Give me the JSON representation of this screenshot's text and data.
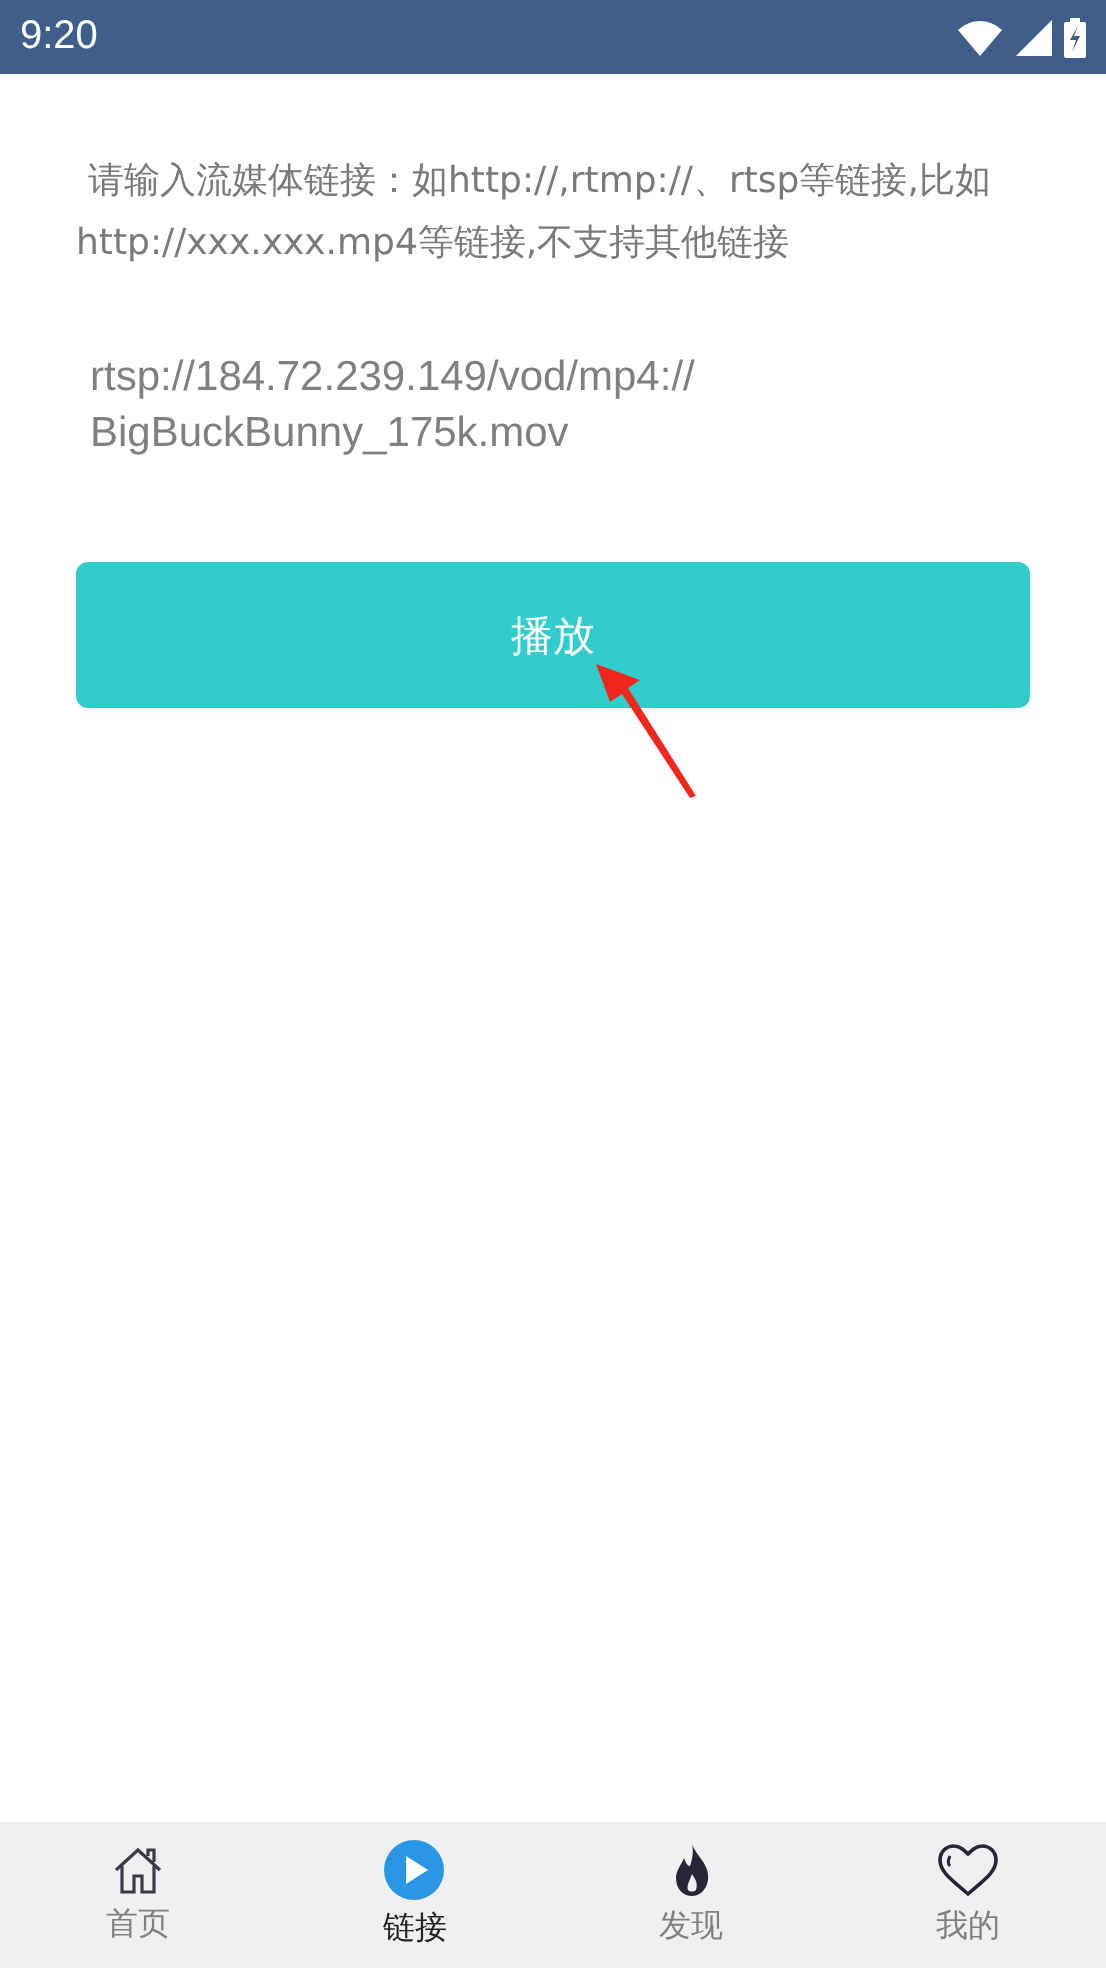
{
  "status_bar": {
    "time": "9:20"
  },
  "hint": "请输入流媒体链接：如http://,rtmp://、rtsp等链接,比如http://xxx.xxx.mp4等链接,不支持其他链接",
  "url_field": {
    "value": "rtsp://184.72.239.149/vod/mp4://\nBigBuckBunny_175k.mov"
  },
  "play_button": {
    "label": "播放"
  },
  "bottom_nav": [
    {
      "label": "首页",
      "kind": "home",
      "selected": false
    },
    {
      "label": "链接",
      "kind": "play",
      "selected": true
    },
    {
      "label": "发现",
      "kind": "flame",
      "selected": false
    },
    {
      "label": "我的",
      "kind": "heart",
      "selected": false
    }
  ]
}
